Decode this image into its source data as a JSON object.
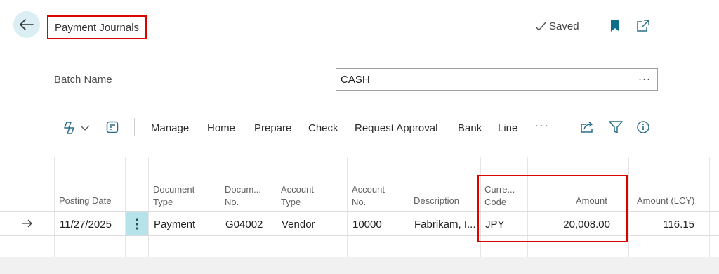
{
  "header": {
    "title": "Payment Journals",
    "saved_status": "Saved"
  },
  "batch": {
    "label": "Batch Name",
    "value": "CASH",
    "more": "···"
  },
  "actions": {
    "menu": [
      "Manage",
      "Home",
      "Prepare",
      "Check",
      "Request Approval",
      "Bank",
      "Line"
    ],
    "more": "···"
  },
  "grid": {
    "columns": {
      "posting_date": "Posting Date",
      "doc_type_1": "Document",
      "doc_type_2": "Type",
      "doc_no_1": "Docum...",
      "doc_no_2": "No.",
      "acct_type_1": "Account",
      "acct_type_2": "Type",
      "acct_no_1": "Account",
      "acct_no_2": "No.",
      "description": "Description",
      "currency_1": "Curre...",
      "currency_2": "Code",
      "amount": "Amount",
      "amount_lcy": "Amount (LCY)"
    },
    "row": {
      "posting_date": "11/27/2025",
      "document_type": "Payment",
      "document_no": "G04002",
      "account_type": "Vendor",
      "account_no": "10000",
      "description": "Fabrikam, I...",
      "currency_code": "JPY",
      "amount": "20,008.00",
      "amount_lcy": "116.15"
    }
  },
  "colors": {
    "accent": "#2a6e8a",
    "highlight": "#e00000",
    "back_button_bg": "#dbeef3",
    "selected_cell": "#b5e3e9"
  },
  "icons": [
    "back-arrow-icon",
    "checkmark-icon",
    "bookmark-icon",
    "popout-icon",
    "copilot-icon",
    "chevron-down-icon",
    "edit-list-icon",
    "share-icon",
    "filter-icon",
    "info-icon",
    "row-arrow-icon",
    "vertical-ellipsis-icon"
  ]
}
